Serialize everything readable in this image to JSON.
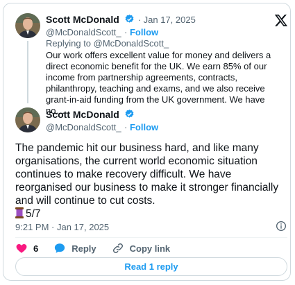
{
  "reply_tweet": {
    "author": "Scott McDonald",
    "date": "Jan 17, 2025",
    "handle": "@McDonaldScott_",
    "follow": "Follow",
    "replying_to_prefix": "Replying to ",
    "replying_to": "@McDonaldScott_",
    "text": "Our work offers excellent value for money and delivers a direct economic benefit for the UK. We earn 85% of our income from partnership agreements, contracts, philanthropy, teaching and exams, and we also receive grant-in-aid funding from the UK government. We have no…"
  },
  "main_tweet": {
    "author": "Scott McDonald",
    "handle": "@McDonaldScott_",
    "follow": "Follow",
    "text": "The pandemic hit our business hard, and like many organisations, the current world economic situation continues to make recovery difficult. We have reorganised our business to make it stronger financially and will continue to cut costs.",
    "thread_counter": "5/7",
    "timestamp": "9:21 PM · Jan 17, 2025"
  },
  "actions": {
    "likes": "6",
    "reply_label": "Reply",
    "copy_label": "Copy link"
  },
  "read_replies_label": "Read 1 reply",
  "icons": {
    "logo": "x-logo-icon",
    "verified": "verified-badge-icon",
    "heart": "heart-icon",
    "reply": "speech-bubble-icon",
    "link": "link-icon",
    "info": "info-icon",
    "thread": "spool-of-thread-icon"
  },
  "colors": {
    "accent": "#1d9bf0",
    "like": "#f91880",
    "muted": "#536471"
  }
}
